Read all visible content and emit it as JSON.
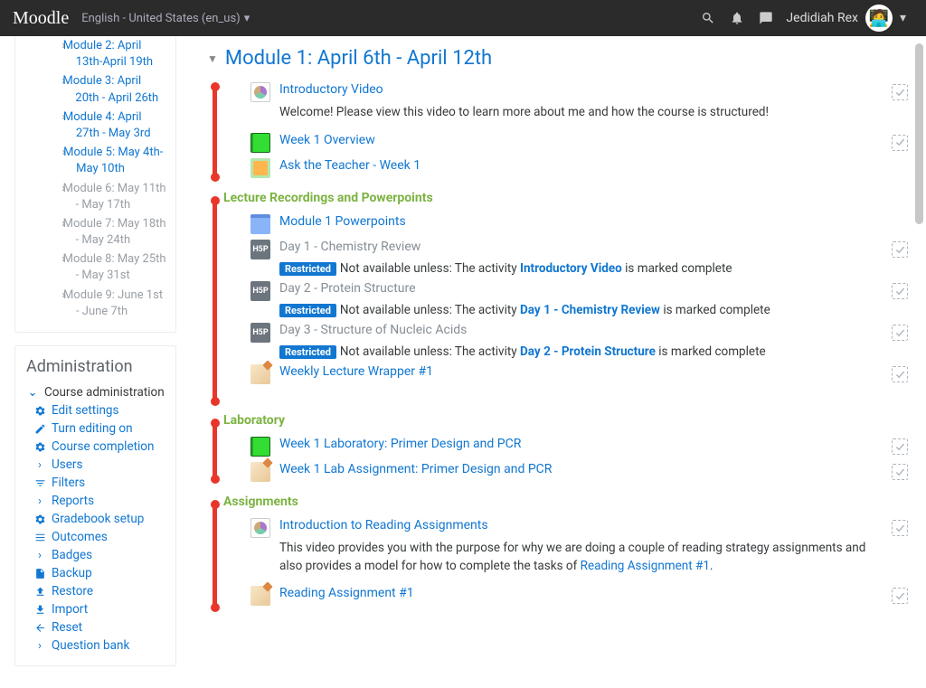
{
  "navbar": {
    "brand": "Moodle",
    "language": "English - United States (en_us)",
    "username": "Jedidiah Rex"
  },
  "nav_modules": [
    {
      "label": "Module 2: April 13th-April 19th",
      "muted": false
    },
    {
      "label": "Module 3: April 20th - April 26th",
      "muted": false
    },
    {
      "label": "Module 4: April 27th - May 3rd",
      "muted": false
    },
    {
      "label": "Module 5: May 4th- May 10th",
      "muted": false
    },
    {
      "label": "Module 6: May 11th - May 17th",
      "muted": true
    },
    {
      "label": "Module 7: May 18th - May 24th",
      "muted": true
    },
    {
      "label": "Module 8: May 25th - May 31st",
      "muted": true
    },
    {
      "label": "Module 9: June 1st - June 7th",
      "muted": true
    }
  ],
  "admin": {
    "title": "Administration",
    "header": "Course administration",
    "items": [
      {
        "label": "Edit settings",
        "icon": "gear"
      },
      {
        "label": "Turn editing on",
        "icon": "pencil"
      },
      {
        "label": "Course completion",
        "icon": "gear"
      },
      {
        "label": "Users",
        "icon": "chev"
      },
      {
        "label": "Filters",
        "icon": "filter"
      },
      {
        "label": "Reports",
        "icon": "chev"
      },
      {
        "label": "Gradebook setup",
        "icon": "gear"
      },
      {
        "label": "Outcomes",
        "icon": "list"
      },
      {
        "label": "Badges",
        "icon": "chev"
      },
      {
        "label": "Backup",
        "icon": "file"
      },
      {
        "label": "Restore",
        "icon": "upload"
      },
      {
        "label": "Import",
        "icon": "download"
      },
      {
        "label": "Reset",
        "icon": "left"
      },
      {
        "label": "Question bank",
        "icon": "chev"
      }
    ]
  },
  "section": {
    "title": "Module 1: April 6th - April 12th"
  },
  "labels": {
    "lectures": "Lecture Recordings and Powerpoints",
    "laboratory": "Laboratory",
    "assignments": "Assignments",
    "restricted": "Restricted",
    "not_avail_prefix": "Not available unless: The activity ",
    "not_avail_suffix": " is marked complete"
  },
  "activities": {
    "intro_video": {
      "name": "Introductory Video",
      "desc": "Welcome! Please view this video to learn more about me and how the course is structured!"
    },
    "week1_overview": {
      "name": "Week 1 Overview"
    },
    "ask_teacher": {
      "name": "Ask the Teacher - Week 1"
    },
    "powerpoints": {
      "name": "Module 1 Powerpoints"
    },
    "day1": {
      "name": "Day 1 - Chemistry Review",
      "lock": "Introductory Video"
    },
    "day2": {
      "name": "Day 2 - Protein Structure",
      "lock": "Day 1 - Chemistry Review"
    },
    "day3": {
      "name": "Day 3 - Structure of Nucleic Acids",
      "lock": "Day 2 - Protein Structure"
    },
    "wrapper": {
      "name": "Weekly Lecture Wrapper #1"
    },
    "lab_book": {
      "name": "Week 1 Laboratory: Primer Design and PCR"
    },
    "lab_assign": {
      "name": "Week 1 Lab Assignment: Primer Design and PCR"
    },
    "read_intro": {
      "name": "Introduction to Reading Assignments",
      "desc_pre": "This video provides you with the purpose for why we are doing a couple of reading strategy assignments and also provides a model for how to complete the tasks of ",
      "desc_link": "Reading Assignment #1",
      "desc_post": "."
    },
    "reading1": {
      "name": "Reading Assignment #1"
    }
  }
}
